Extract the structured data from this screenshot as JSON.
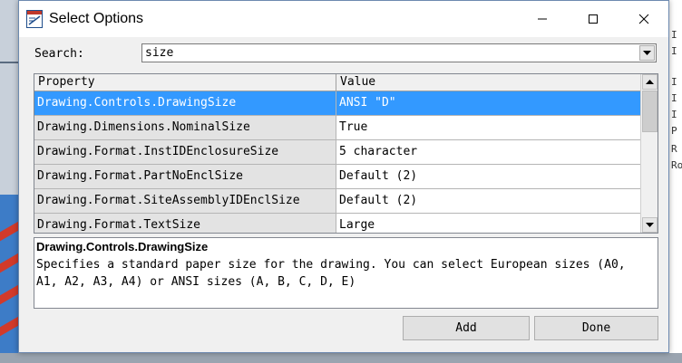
{
  "window": {
    "title": "Select Options"
  },
  "search": {
    "label": "Search:",
    "value": "size"
  },
  "grid": {
    "columns": [
      "Property",
      "Value"
    ],
    "rows": [
      {
        "property": "Drawing.Controls.DrawingSize",
        "value": "ANSI \"D\"",
        "selected": true
      },
      {
        "property": "Drawing.Dimensions.NominalSize",
        "value": "True",
        "selected": false
      },
      {
        "property": "Drawing.Format.InstIDEnclosureSize",
        "value": "5 character",
        "selected": false
      },
      {
        "property": "Drawing.Format.PartNoEnclSize",
        "value": "Default (2)",
        "selected": false
      },
      {
        "property": "Drawing.Format.SiteAssemblyIDEnclSize",
        "value": "Default (2)",
        "selected": false
      },
      {
        "property": "Drawing.Format.TextSize",
        "value": "Large",
        "selected": false
      }
    ]
  },
  "description": {
    "title": "Drawing.Controls.DrawingSize",
    "text": "Specifies a standard paper size for the drawing. You can select European sizes (A0, A1, A2, A3, A4) or ANSI sizes (A, B, C, D, E)"
  },
  "buttons": {
    "add": "Add",
    "done": "Done"
  },
  "background": {
    "right_fragment_letters": [
      "I",
      "I",
      "I",
      "I",
      "I",
      "P",
      "R",
      "Ro"
    ]
  },
  "colors": {
    "selection": "#3399ff",
    "dialog_bg": "#f0f0f0",
    "property_cell_bg": "#e3e3e3"
  },
  "icons": {
    "app": "drawing-app-icon",
    "minimize": "minimize-icon",
    "maximize": "maximize-icon",
    "close": "close-icon",
    "dropdown": "chevron-down-icon",
    "scroll_up": "triangle-up-icon",
    "scroll_down": "triangle-down-icon"
  }
}
